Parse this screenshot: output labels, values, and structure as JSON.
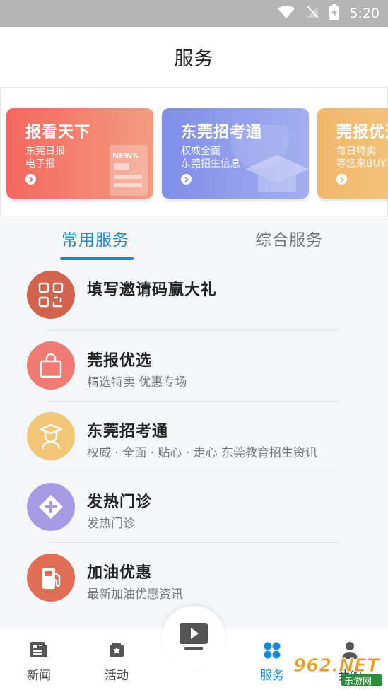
{
  "status_bar": {
    "time": "5:20"
  },
  "header": {
    "title": "服务"
  },
  "banners": [
    {
      "title": "报看天下",
      "line1": "东莞日报",
      "line2": "电子报",
      "deco": "NEWS"
    },
    {
      "title": "东莞招考通",
      "line1": "权威全面",
      "line2": "东莞招生信息"
    },
    {
      "title": "莞报优选",
      "line1": "每日特卖",
      "line2": "等您来BUY"
    }
  ],
  "tabs": [
    {
      "label": "常用服务",
      "active": true
    },
    {
      "label": "综合服务",
      "active": false
    }
  ],
  "services": [
    {
      "title": "填写邀请码赢大礼",
      "subtitle": "",
      "icon": "qr-code-icon",
      "color": "#d2644f"
    },
    {
      "title": "莞报优选",
      "subtitle": "精选特卖 优惠专场",
      "icon": "shopping-bag-icon",
      "color": "#f07b74"
    },
    {
      "title": "东莞招考通",
      "subtitle": "权威 · 全面 · 贴心 · 走心 东莞教育招生资讯",
      "icon": "graduate-icon",
      "color": "#f2c777"
    },
    {
      "title": "发热门诊",
      "subtitle": "发热门诊",
      "icon": "medical-cross-icon",
      "color": "#a79be4"
    },
    {
      "title": "加油优惠",
      "subtitle": "最新加油优惠资讯",
      "icon": "fuel-pump-icon",
      "color": "#e06e55"
    }
  ],
  "bottom_nav": [
    {
      "label": "新闻",
      "icon": "newspaper-icon"
    },
    {
      "label": "活动",
      "icon": "activity-icon"
    },
    {
      "label": "服务",
      "icon": "grid-icon",
      "active": true
    },
    {
      "label": "我的",
      "icon": "user-icon"
    }
  ],
  "watermark": {
    "text_top": "962.NET",
    "text_bottom": "乐游网"
  },
  "colors": {
    "accent": "#1a8ad8"
  }
}
